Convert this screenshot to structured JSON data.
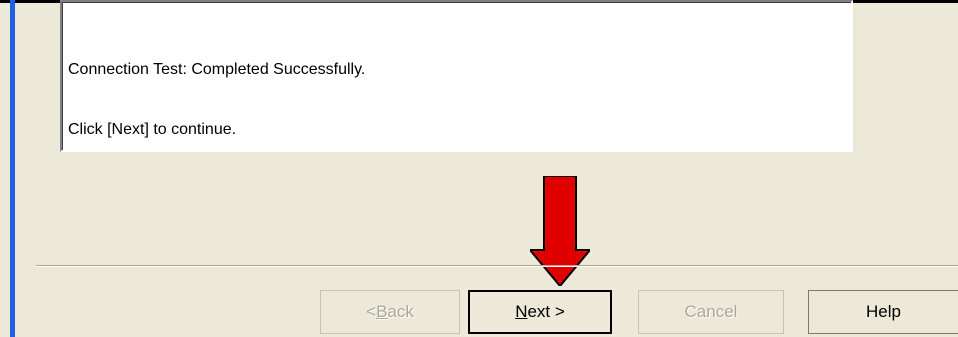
{
  "message": {
    "line1": "Connection Test: Completed Successfully.",
    "line2": "Click [Next] to continue."
  },
  "buttons": {
    "back": {
      "prefix": "< ",
      "mnemonic": "B",
      "rest": "ack"
    },
    "next": {
      "mnemonic": "N",
      "rest": "ext >"
    },
    "cancel": "Cancel",
    "help": "Help"
  },
  "colors": {
    "dialog_bg": "#ECE9D8",
    "accent_bar": "#1F5FE0",
    "arrow": "#E00000",
    "disabled_text": "#ACA899"
  },
  "icons": {
    "pointer_arrow": "red-down-arrow-icon"
  }
}
